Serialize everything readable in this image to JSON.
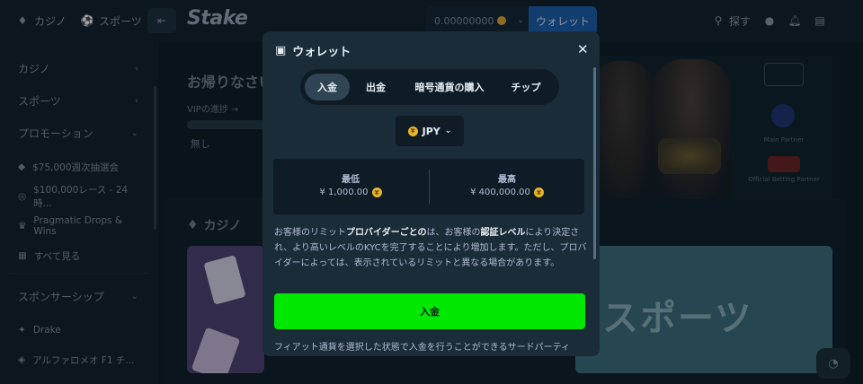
{
  "topbar": {
    "casino_label": "カジノ",
    "sports_label": "スポーツ",
    "logo": "Stake",
    "balance": "0.00000000",
    "wallet_label": "ウォレット",
    "search_label": "探す"
  },
  "sidebar": {
    "items": [
      {
        "label": "カジノ",
        "icon": ""
      },
      {
        "label": "スポーツ",
        "icon": ""
      },
      {
        "label": "プロモーション",
        "icon": ""
      },
      {
        "label": "$75,000週次抽選会",
        "icon": "ticket-icon"
      },
      {
        "label": "$100,000レース - 24時...",
        "icon": "race-icon"
      },
      {
        "label": "Pragmatic Drops & Wins",
        "icon": "trophy-icon"
      },
      {
        "label": "すべて見る",
        "icon": "grid-icon"
      },
      {
        "label": "スポンサーシップ",
        "icon": ""
      },
      {
        "label": "Drake",
        "icon": "star-icon"
      },
      {
        "label": "アルファロメオ F1 チ...",
        "icon": "car-icon"
      }
    ]
  },
  "main": {
    "greeting": "お帰りなさい",
    "vip_progress": "VIPの進捗 →",
    "none_label": "無し",
    "casino_section": "カジノ",
    "sports_tile_text": "スポーツ",
    "partners": [
      "Main Partner",
      "Official Betting Partner"
    ]
  },
  "modal": {
    "title": "ウォレット",
    "tabs": [
      "入金",
      "出金",
      "暗号通貨の購入",
      "チップ"
    ],
    "active_tab": "入金",
    "currency": "JPY",
    "min_label": "最低",
    "min_value": "¥ 1,000.00",
    "max_label": "最高",
    "max_value": "¥ 400,000.00",
    "info_p1": "お客様のリミット",
    "info_b1": "プロバイダーごとの",
    "info_p2": "は、お客様の",
    "info_b2": "認証レベル",
    "info_p3": "により決定され、より高いレベルのKYCを完了することにより増加します。ただし、プロバイダーによっては、表示されているリミットと異なる場合があります。",
    "deposit_button": "入金",
    "info_2": "フィアット通貨を選択した状態で入金を行うことができるサードパーティ"
  },
  "colors": {
    "accent_green": "#00e701",
    "wallet_blue": "#1a5ba8",
    "modal_bg": "#1a2c38"
  }
}
